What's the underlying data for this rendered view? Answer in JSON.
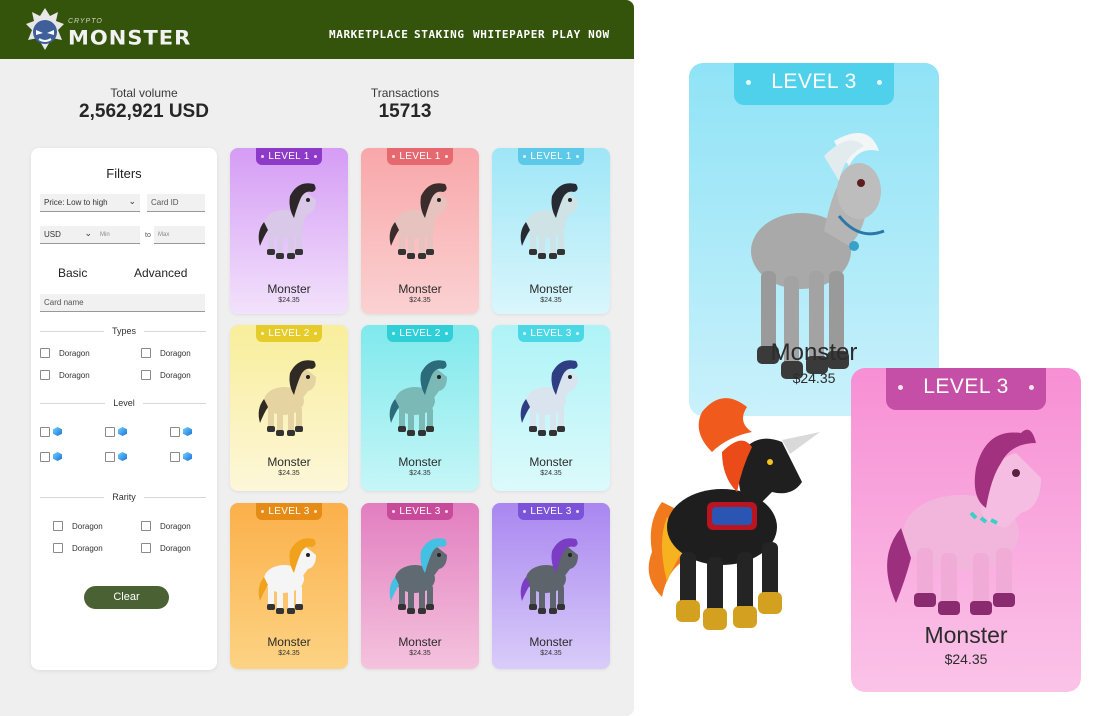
{
  "brand": {
    "small": "CRYPTO",
    "big": "MONSTER"
  },
  "nav": [
    "MARKETPLACE",
    "STAKING",
    "WHITEPAPER",
    "PLAY NOW"
  ],
  "stats": {
    "volume_label": "Total volume",
    "volume_value": "2,562,921 USD",
    "tx_label": "Transactions",
    "tx_value": "15713"
  },
  "filters": {
    "title": "Filters",
    "sort_value": "Price: Low to high",
    "card_id_placeholder": "Card ID",
    "currency_value": "USD",
    "min_placeholder": "Min",
    "to_label": "to",
    "max_placeholder": "Max",
    "tab_basic": "Basic",
    "tab_advanced": "Advanced",
    "card_name_placeholder": "Card name",
    "types_label": "Types",
    "types": [
      "Doragon",
      "Doragon",
      "Doragon",
      "Doragon"
    ],
    "level_label": "Level",
    "rarity_label": "Rarity",
    "rarity": [
      "Doragon",
      "Doragon",
      "Doragon",
      "Doragon"
    ],
    "clear_label": "Clear"
  },
  "cards": [
    {
      "level": "LEVEL 1",
      "name": "Monster",
      "price": "$24.35",
      "bg_top": "#d59cf5",
      "bg_bottom": "#f2e2fb",
      "ribbon": "#8e3ac9",
      "body": "#d9c8e7",
      "mane": "#2d2628"
    },
    {
      "level": "LEVEL 1",
      "name": "Monster",
      "price": "$24.35",
      "bg_top": "#f8a7a9",
      "bg_bottom": "#fbd1d2",
      "ribbon": "#e5696f",
      "body": "#e6c3bf",
      "mane": "#3a2c2b"
    },
    {
      "level": "LEVEL 1",
      "name": "Monster",
      "price": "$24.35",
      "bg_top": "#9fe6f7",
      "bg_bottom": "#d9f6fc",
      "ribbon": "#5cc9e9",
      "body": "#cfe3e7",
      "mane": "#262a33"
    },
    {
      "level": "LEVEL 2",
      "name": "Monster",
      "price": "$24.35",
      "bg_top": "#f8ee9b",
      "bg_bottom": "#fdf7d9",
      "ribbon": "#e5cc2b",
      "body": "#e5d3a1",
      "mane": "#2f2a23"
    },
    {
      "level": "LEVEL 2",
      "name": "Monster",
      "price": "$24.35",
      "bg_top": "#7fe9ec",
      "bg_bottom": "#c6f6f7",
      "ribbon": "#2fcfd7",
      "body": "#7ab9b5",
      "mane": "#2c6b7a"
    },
    {
      "level": "LEVEL 3",
      "name": "Monster",
      "price": "$24.35",
      "bg_top": "#aef3f7",
      "bg_bottom": "#dcfafb",
      "ribbon": "#4ad8e6",
      "body": "#d9e4ef",
      "mane": "#2f3e82"
    },
    {
      "level": "LEVEL 3",
      "name": "Monster",
      "price": "$24.35",
      "bg_top": "#fbb04a",
      "bg_bottom": "#fcd384",
      "ribbon": "#e68c16",
      "body": "#f5f5f5",
      "mane": "#f0a21d"
    },
    {
      "level": "LEVEL 3",
      "name": "Monster",
      "price": "$24.35",
      "bg_top": "#e27ec0",
      "bg_bottom": "#f4c3dd",
      "ribbon": "#c74a9b",
      "body": "#5f6a72",
      "mane": "#43c0e2"
    },
    {
      "level": "LEVEL 3",
      "name": "Monster",
      "price": "$24.35",
      "bg_top": "#a987f0",
      "bg_bottom": "#d9ccf9",
      "ribbon": "#7a53d8",
      "body": "#5d646c",
      "mane": "#7b3dc4"
    }
  ],
  "showcase": {
    "blue": {
      "level": "LEVEL 3",
      "name": "Monster",
      "price": "$24.35"
    },
    "pink": {
      "level": "LEVEL 3",
      "name": "Monster",
      "price": "$24.35"
    }
  }
}
